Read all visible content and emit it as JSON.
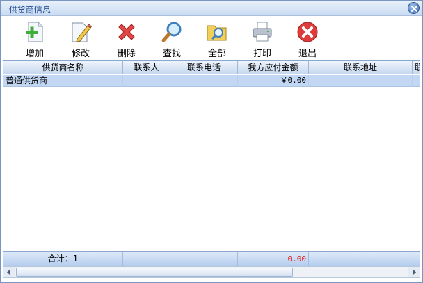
{
  "window": {
    "title": "供货商信息"
  },
  "toolbar": {
    "add": "增加",
    "edit": "修改",
    "delete": "删除",
    "find": "查找",
    "all": "全部",
    "print": "打印",
    "exit": "退出"
  },
  "grid": {
    "columns": [
      "供货商名称",
      "联系人",
      "联系电话",
      "我方应付金额",
      "联系地址",
      "联"
    ],
    "rows": [
      {
        "name": "普通供货商",
        "contact": "",
        "phone": "",
        "payable": "￥0.00",
        "address": ""
      }
    ]
  },
  "footer": {
    "count_label": "合计：1",
    "total_payable": "0.00"
  },
  "colors": {
    "selected_row": "#c2d7f3",
    "total_text": "#e02020",
    "title_text": "#15428b"
  }
}
